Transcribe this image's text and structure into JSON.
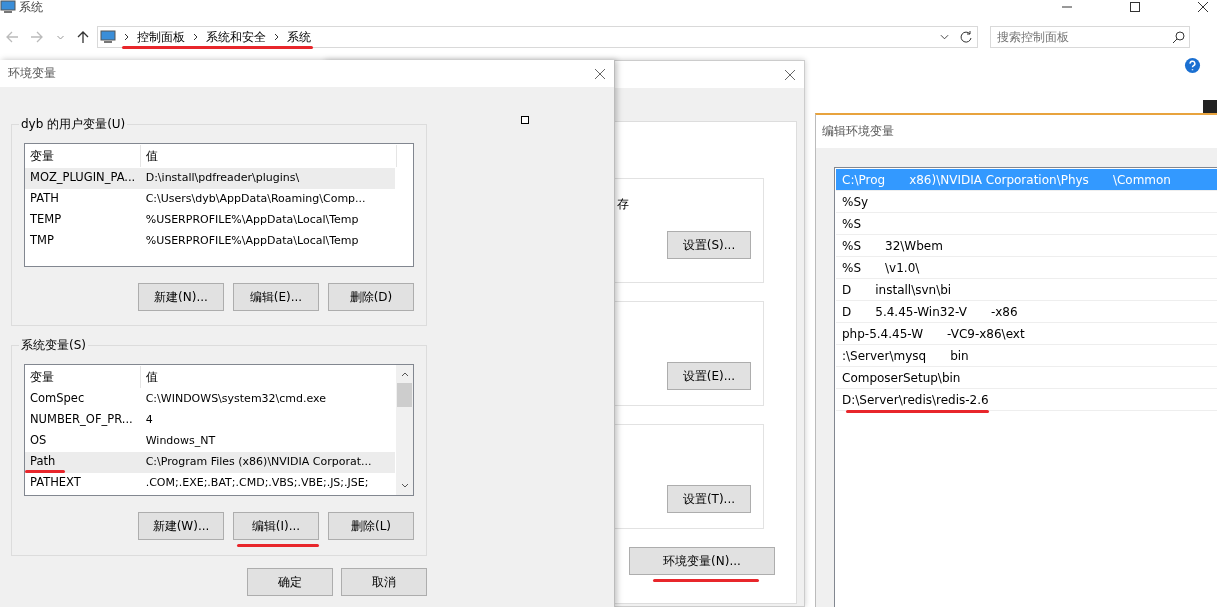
{
  "explorer": {
    "title": "系统",
    "breadcrumbs": [
      "控制面板",
      "系统和安全",
      "系统"
    ],
    "path_marked": true,
    "search": {
      "placeholder": "搜索控制面板"
    }
  },
  "system_properties": {
    "partial_text": "存",
    "group_buttons": [
      {
        "label": "设置(S)...",
        "marked": false
      },
      {
        "label": "设置(E)...",
        "marked": false
      },
      {
        "label": "设置(T)...",
        "marked": false
      }
    ],
    "env_button": {
      "label": "环境变量(N)...",
      "marked": true
    }
  },
  "env_dialog": {
    "title": "环境变量",
    "user_group": {
      "title": "dyb 的用户变量(U)",
      "columns": [
        "变量",
        "值"
      ],
      "rows": [
        {
          "name": "MOZ_PLUGIN_PA...",
          "value": "D:\\install\\pdfreader\\plugins\\",
          "selected": true,
          "marked": false
        },
        {
          "name": "PATH",
          "value": "C:\\Users\\dyb\\AppData\\Roaming\\Comp...",
          "selected": false,
          "marked": false
        },
        {
          "name": "TEMP",
          "value": "%USERPROFILE%\\AppData\\Local\\Temp",
          "selected": false,
          "marked": false
        },
        {
          "name": "TMP",
          "value": "%USERPROFILE%\\AppData\\Local\\Temp",
          "selected": false,
          "marked": false
        }
      ],
      "buttons": [
        {
          "label": "新建(N)...",
          "marked": false
        },
        {
          "label": "编辑(E)...",
          "marked": false
        },
        {
          "label": "删除(D)",
          "marked": false
        }
      ]
    },
    "system_group": {
      "title": "系统变量(S)",
      "columns": [
        "变量",
        "值"
      ],
      "rows": [
        {
          "name": "ComSpec",
          "value": "C:\\WINDOWS\\system32\\cmd.exe",
          "selected": false,
          "marked": false
        },
        {
          "name": "NUMBER_OF_PR...",
          "value": "4",
          "selected": false,
          "marked": false
        },
        {
          "name": "OS",
          "value": "Windows_NT",
          "selected": false,
          "marked": false
        },
        {
          "name": "Path",
          "value": "C:\\Program Files (x86)\\NVIDIA Corporat...",
          "selected": true,
          "marked": true
        },
        {
          "name": "PATHEXT",
          "value": ".COM;.EXE;.BAT;.CMD;.VBS;.VBE;.JS;.JSE;",
          "selected": false,
          "marked": false
        }
      ],
      "buttons": [
        {
          "label": "新建(W)...",
          "marked": false
        },
        {
          "label": "编辑(I)...",
          "marked": true
        },
        {
          "label": "删除(L)",
          "marked": false
        }
      ]
    },
    "buttons": [
      {
        "label": "确定",
        "marked": false
      },
      {
        "label": "取消",
        "marked": false
      }
    ]
  },
  "edit_dialog": {
    "title": "编辑环境变量",
    "entries": [
      {
        "parts": [
          "C:\\Prog",
          "x86)\\NVIDIA Corporation\\Phys",
          "\\Common"
        ],
        "selected": true,
        "marked": false
      },
      {
        "parts": [
          "%Sy"
        ],
        "selected": false,
        "marked": false
      },
      {
        "parts": [
          "%S"
        ],
        "selected": false,
        "marked": false
      },
      {
        "parts": [
          "%S",
          "32\\Wbem"
        ],
        "selected": false,
        "marked": false
      },
      {
        "parts": [
          "%S",
          "\\v1.0\\"
        ],
        "selected": false,
        "marked": false
      },
      {
        "parts": [
          "D",
          "install\\svn\\bi"
        ],
        "selected": false,
        "marked": false
      },
      {
        "parts": [
          "D",
          "5.4.45-Win32-V",
          "-x86"
        ],
        "selected": false,
        "marked": false
      },
      {
        "parts": [
          "php-5.4.45-W",
          "-VC9-x86\\ext"
        ],
        "selected": false,
        "marked": false
      },
      {
        "parts": [
          ":\\Server\\mysq",
          "bin"
        ],
        "selected": false,
        "marked": false
      },
      {
        "parts": [
          "ComposerSetup\\bin"
        ],
        "selected": false,
        "marked": false
      },
      {
        "parts": [
          "D:\\Server\\redis\\redis-2.6"
        ],
        "selected": false,
        "marked": true
      }
    ]
  }
}
